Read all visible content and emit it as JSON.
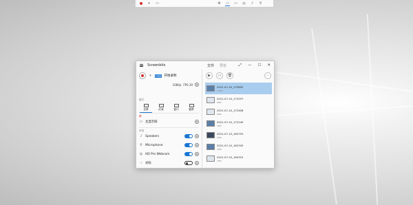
{
  "toolbar": {
    "items": [
      "record",
      "pause",
      "open-folder",
      "settings",
      "screen",
      "screen-alt",
      "webcam",
      "audio",
      "microphone"
    ]
  },
  "window": {
    "title": "Screenbits",
    "tabs": [
      "文件",
      "预览"
    ],
    "controls": {
      "pin": "⤢",
      "minimize": "—",
      "maximize": "☐",
      "close": "✕"
    }
  },
  "recorder": {
    "fps_badge": "FHD",
    "start_label": "开始录制",
    "format_label": "1080p",
    "format2_label": "FPS 30",
    "mode_section": "模式",
    "modes": [
      {
        "label": "全屏",
        "active": true
      },
      {
        "label": "区域",
        "active": false
      },
      {
        "label": "窗口",
        "active": false
      },
      {
        "label": "截屏",
        "active": false
      }
    ],
    "screen_section": "屏",
    "screen_item": "主显示屏",
    "sound_section": "声音",
    "sources": [
      {
        "label": "Speakers",
        "on": true
      },
      {
        "label": "Microphone",
        "on": true
      },
      {
        "label": "HD Pro Webcam",
        "on": true
      },
      {
        "label": "光标",
        "on": false
      }
    ]
  },
  "files": [
    {
      "name": "2021-07-10_173652",
      "size": "12MB",
      "selected": true
    },
    {
      "name": "2021-07-10_173257",
      "size": "8MB",
      "selected": false
    },
    {
      "name": "2021-07-10_172408",
      "size": "6MB",
      "selected": false
    },
    {
      "name": "2021-07-10_172240",
      "size": "3MB",
      "selected": false
    },
    {
      "name": "2021-07-10_163753",
      "size": "5MB",
      "selected": false
    },
    {
      "name": "2021-07-10_163705",
      "size": "4MB",
      "selected": false
    },
    {
      "name": "2021-07-10_164315",
      "size": "7MB",
      "selected": false
    }
  ]
}
